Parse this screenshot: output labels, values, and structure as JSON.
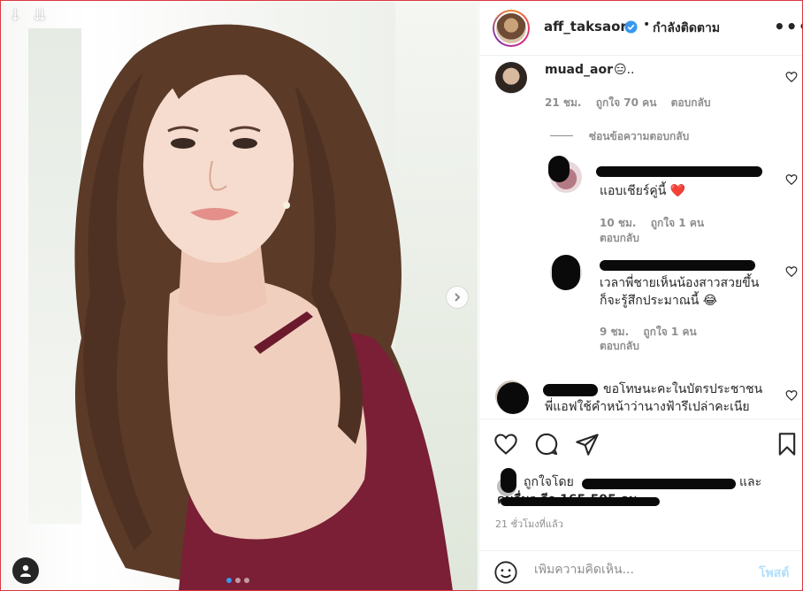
{
  "header": {
    "username": "aff_taksaorn",
    "separator": "•",
    "follow_status": "กำลังติดตาม",
    "more_label": "•••"
  },
  "comments": [
    {
      "username": "muad_aor",
      "text": "😑..",
      "time": "21 ชม.",
      "likes": "ถูกใจ 70 คน",
      "reply": "ตอบกลับ",
      "hide_replies": "ซ่อนข้อความตอบกลับ"
    },
    {
      "text": "แอบเชียร์คู่นี้ ❤️",
      "time": "10 ชม.",
      "likes": "ถูกใจ 1 คน",
      "reply": "ตอบกลับ"
    },
    {
      "text_line1": "เวลาพี่ชายเห็นน้องสาวสวยขึ้น",
      "text_line2": "ก็จะรู้สึกประมาณนี้ 😂",
      "time": "9 ชม.",
      "likes": "ถูกใจ 1 คน",
      "reply": "ตอบกลับ"
    },
    {
      "text_line1": "ขอโทษนะคะในบัตรประชาชน",
      "text_line2": "พี่แอฟใช้คำหน้าว่านางฟ้ารึเปล่าคะเนีย"
    }
  ],
  "likes": {
    "prefix": "ถูกใจโดย",
    "suffix": "และ",
    "others": "คนอื่นๆ อีก 165,595 คน"
  },
  "timestamp": "21 ชั่วโมงที่แล้ว",
  "comment_box": {
    "placeholder": "เพิ่มความคิดเห็น...",
    "post_label": "โพสต์"
  },
  "colors": {
    "accent": "#3897f0",
    "post_disabled": "#b2dffc",
    "dress": "#7a1f35",
    "hair": "#5b3a28",
    "skin": "#f3d6c7"
  }
}
